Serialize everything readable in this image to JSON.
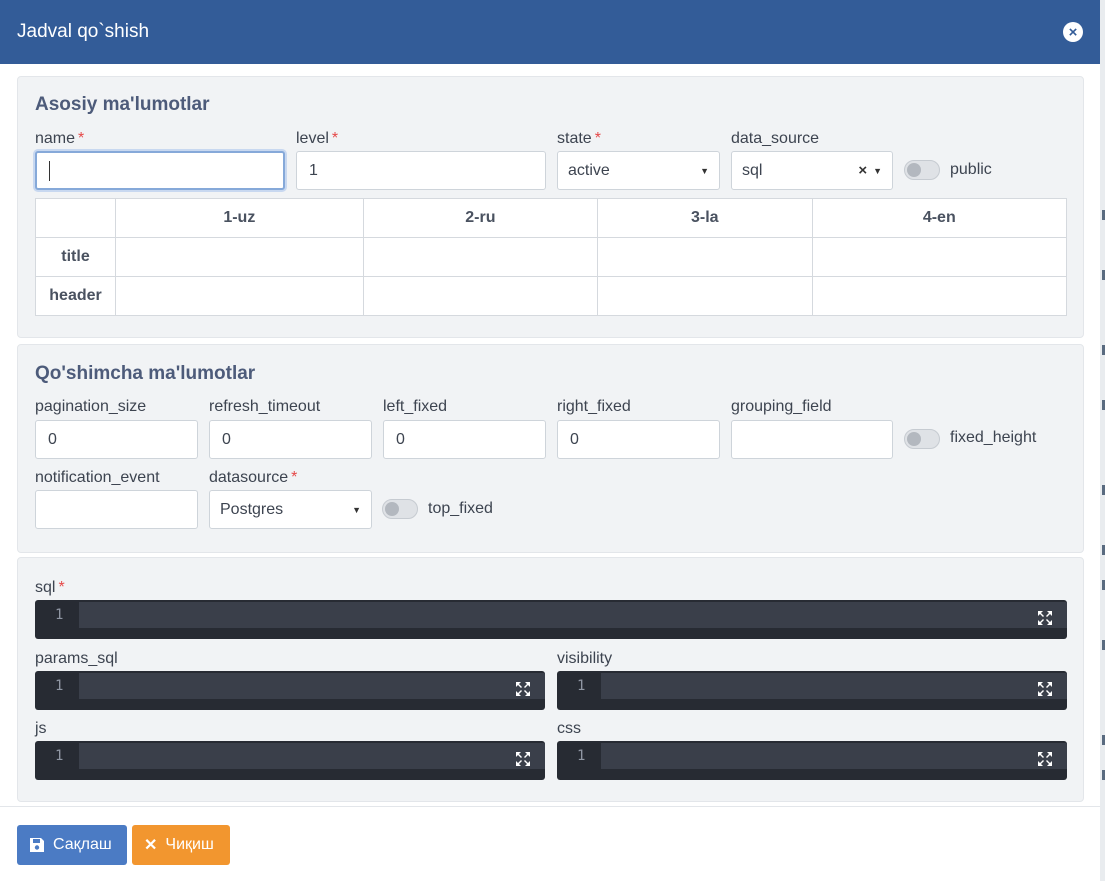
{
  "modal": {
    "title": "Jadval qo`shish",
    "close_icon": "times-circle-icon"
  },
  "basic": {
    "title": "Asosiy ma'lumotlar",
    "name": {
      "label": "name",
      "required": "*",
      "value": ""
    },
    "level": {
      "label": "level",
      "required": "*",
      "value": "1"
    },
    "state": {
      "label": "state",
      "required": "*",
      "value": "active"
    },
    "data_source": {
      "label": "data_source",
      "value": "sql",
      "clear": "×"
    },
    "public_toggle": {
      "label": "public"
    },
    "table": {
      "columns": [
        "1-uz",
        "2-ru",
        "3-la",
        "4-en"
      ],
      "rows": [
        "title",
        "header"
      ]
    }
  },
  "extra": {
    "title": "Qo'shimcha ma'lumotlar",
    "pagination_size": {
      "label": "pagination_size",
      "value": "0"
    },
    "refresh_timeout": {
      "label": "refresh_timeout",
      "value": "0"
    },
    "left_fixed": {
      "label": "left_fixed",
      "value": "0"
    },
    "right_fixed": {
      "label": "right_fixed",
      "value": "0"
    },
    "grouping_field": {
      "label": "grouping_field",
      "value": ""
    },
    "fixed_height_toggle": {
      "label": "fixed_height"
    },
    "notification_event": {
      "label": "notification_event",
      "value": ""
    },
    "datasource": {
      "label": "datasource",
      "required": "*",
      "value": "Postgres"
    },
    "top_fixed_toggle": {
      "label": "top_fixed"
    }
  },
  "code": {
    "sql": {
      "label": "sql",
      "required": "*",
      "line": "1"
    },
    "params_sql": {
      "label": "params_sql",
      "line": "1"
    },
    "visibility": {
      "label": "visibility",
      "line": "1"
    },
    "js": {
      "label": "js",
      "line": "1"
    },
    "css": {
      "label": "css",
      "line": "1"
    }
  },
  "footer": {
    "save_label": "Сақлаш",
    "exit_label": "Чиқиш",
    "exit_glyph": "✕",
    "save_icon": "floppy-disk-icon",
    "exit_icon": "times-icon"
  }
}
